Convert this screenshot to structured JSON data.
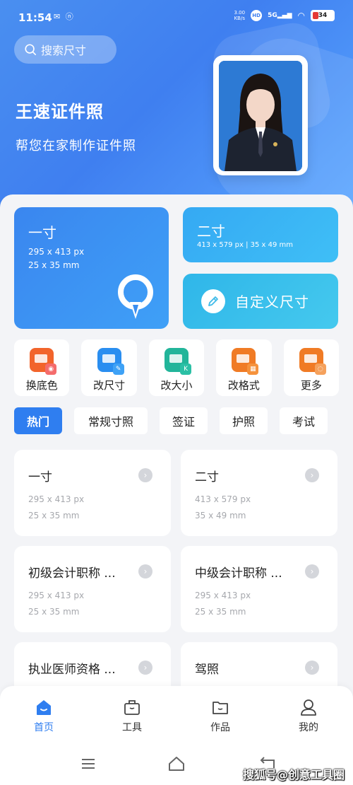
{
  "status_bar": {
    "time": "11:54",
    "left_icons": "✉ ⓝ",
    "net_speed_top": "3.00",
    "net_speed_bottom": "KB/s",
    "hd": "HD",
    "signal": "5G",
    "battery": "34"
  },
  "header": {
    "search_placeholder": "搜索尺寸",
    "app_title": "王速证件照",
    "app_subtitle": "帮您在家制作证件照"
  },
  "featured": {
    "card1": {
      "title": "一寸",
      "px": "295 x 413 px",
      "mm": "25 x 35 mm"
    },
    "card2": {
      "title": "二寸",
      "spec": "413 x 579 px | 35 x 49 mm"
    },
    "card3": {
      "title": "自定义尺寸"
    }
  },
  "tools": [
    {
      "label": "换底色",
      "color": "#f2642b",
      "mark_color": "#f46c6c",
      "mark": "◉"
    },
    {
      "label": "改尺寸",
      "color": "#2a8ef0",
      "mark_color": "#3fa2f6",
      "mark": "✎"
    },
    {
      "label": "改大小",
      "color": "#22b59a",
      "mark_color": "#2bc0a5",
      "mark": "K"
    },
    {
      "label": "改格式",
      "color": "#f07b25",
      "mark_color": "#f5923c",
      "mark": "▦"
    },
    {
      "label": "更多",
      "color": "#f07b25",
      "mark_color": "#f5a15c",
      "mark": "◌"
    }
  ],
  "tabs": [
    {
      "label": "热门",
      "active": true
    },
    {
      "label": "常规寸照",
      "active": false
    },
    {
      "label": "签证",
      "active": false
    },
    {
      "label": "护照",
      "active": false
    },
    {
      "label": "考试",
      "active": false
    }
  ],
  "sizes": [
    {
      "name": "一寸",
      "px": "295 x 413 px",
      "mm": "25 x 35 mm"
    },
    {
      "name": "二寸",
      "px": "413 x 579 px",
      "mm": "35 x 49 mm"
    },
    {
      "name": "初级会计职称 ...",
      "px": "295 x 413 px",
      "mm": "25 x 35 mm"
    },
    {
      "name": "中级会计职称 ...",
      "px": "295 x 413 px",
      "mm": "25 x 35 mm"
    },
    {
      "name": "执业医师资格 ...",
      "px": "",
      "mm": ""
    },
    {
      "name": "驾照",
      "px": "",
      "mm": ""
    }
  ],
  "bottom_nav": [
    {
      "label": "首页",
      "active": true
    },
    {
      "label": "工具",
      "active": false
    },
    {
      "label": "作品",
      "active": false
    },
    {
      "label": "我的",
      "active": false
    }
  ],
  "watermark": "搜狐号@创意工具圈",
  "colors": {
    "primary": "#2f7ef0",
    "hero": "#3f7ff0"
  }
}
